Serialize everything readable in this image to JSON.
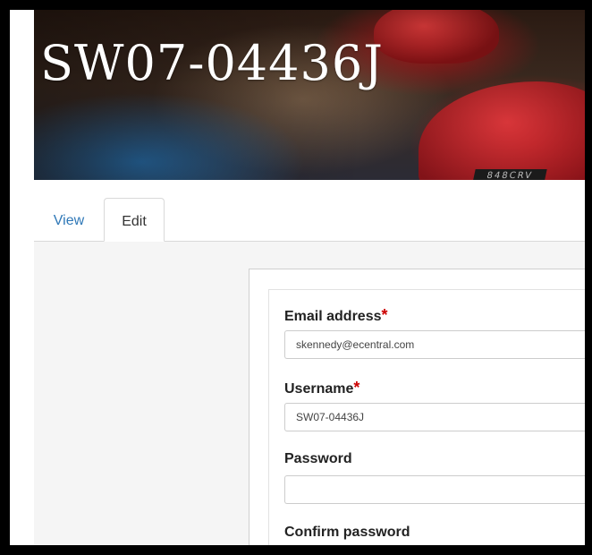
{
  "header": {
    "title": "SW07-04436J",
    "plate_text": "848CRV"
  },
  "tabs": [
    {
      "label": "View",
      "active": false
    },
    {
      "label": "Edit",
      "active": true
    }
  ],
  "form": {
    "email": {
      "label": "Email address",
      "required_mark": "*",
      "value": "skennedy@ecentral.com"
    },
    "username": {
      "label": "Username",
      "required_mark": "*",
      "value": "SW07-04436J"
    },
    "password": {
      "label": "Password",
      "value": ""
    },
    "confirm_password": {
      "label": "Confirm password"
    }
  },
  "colors": {
    "link": "#2f78b7",
    "required": "#cc0000"
  }
}
